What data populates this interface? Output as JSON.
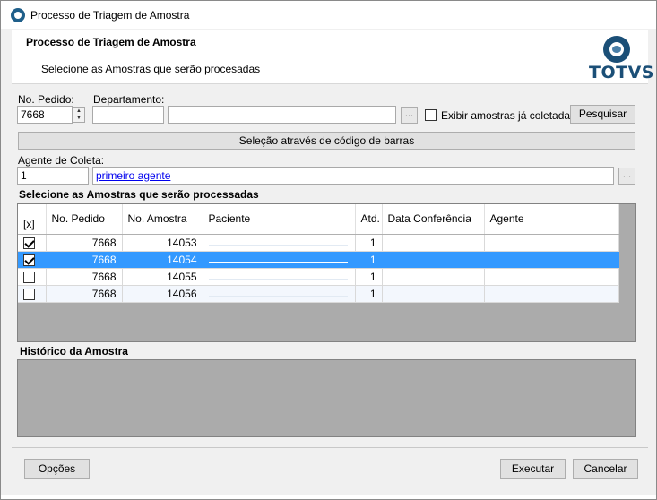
{
  "window": {
    "title": "Processo de Triagem de Amostra"
  },
  "header": {
    "title": "Processo de Triagem de Amostra",
    "subtitle": "Selecione as Amostras que serão procesadas",
    "logo_text": "TOTVS"
  },
  "filters": {
    "pedido_label": "No. Pedido:",
    "pedido_value": "7668",
    "departamento_label": "Departamento:",
    "departamento_code": "",
    "departamento_name": "",
    "browse_label": "...",
    "exibir_label": "Exibir amostras já coletadas",
    "pesquisar_label": "Pesquisar"
  },
  "barcode_button": "Seleção através de código de barras",
  "coleta": {
    "label": "Agente de Coleta:",
    "code": "1",
    "name": "primeiro agente",
    "browse_label": "..."
  },
  "samples_section_title": "Selecione as Amostras que serão processadas",
  "grid": {
    "columns": [
      "[x]",
      "No. Pedido",
      "No. Amostra",
      "Paciente",
      "Atd.",
      "Data Conferência",
      "Agente"
    ],
    "rows": [
      {
        "checked": true,
        "pedido": "7668",
        "amostra": "14053",
        "atd": "1",
        "data": "",
        "agente": ""
      },
      {
        "checked": true,
        "pedido": "7668",
        "amostra": "14054",
        "atd": "1",
        "data": "",
        "agente": ""
      },
      {
        "checked": false,
        "pedido": "7668",
        "amostra": "14055",
        "atd": "1",
        "data": "",
        "agente": ""
      },
      {
        "checked": false,
        "pedido": "7668",
        "amostra": "14056",
        "atd": "1",
        "data": "",
        "agente": ""
      }
    ]
  },
  "history_section_title": "Histórico da Amostra",
  "footer": {
    "opcoes_label": "Opções",
    "executar_label": "Executar",
    "cancelar_label": "Cancelar"
  }
}
